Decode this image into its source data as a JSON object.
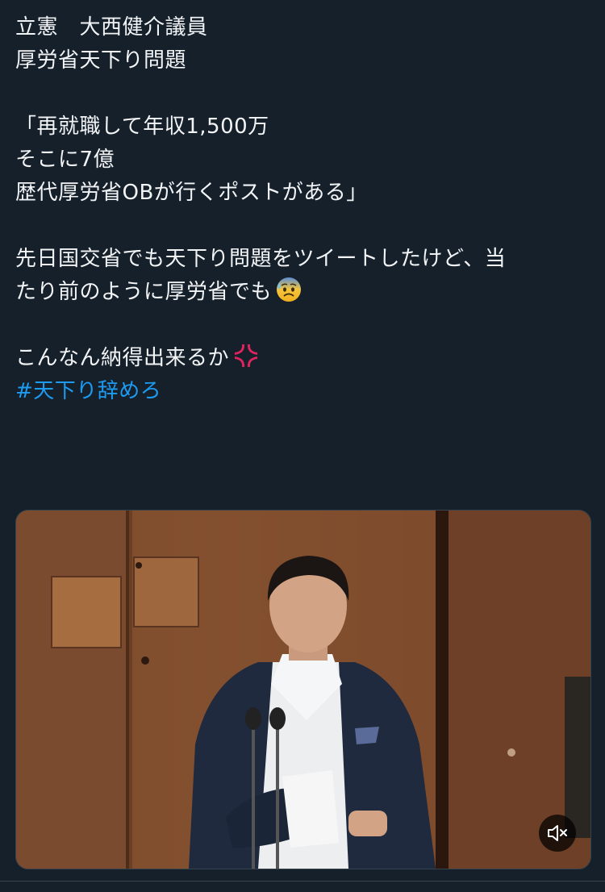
{
  "tweet": {
    "lines": [
      "立憲　大西健介議員",
      "厚労省天下り問題",
      "",
      "「再就職して年収1,500万",
      "そこに7億",
      "歴代厚労省OBが行くポストがある」",
      "",
      "先日国交省でも天下り問題をツイートしたけど、当",
      "たり前のように厚労省でも",
      "",
      "こんなん納得出来るか"
    ],
    "hashtag": "#天下り辞めろ",
    "emoji": {
      "line9": "anxious-face-with-sweat-icon",
      "line11": "anger-symbol-icon"
    }
  },
  "media": {
    "type": "video",
    "description_icon": "video-thumbnail",
    "mute_icon": "speaker-muted-icon"
  },
  "colors": {
    "background": "#15202b",
    "text": "#f2f4f6",
    "link": "#1d9bf0",
    "border": "#38444d"
  }
}
